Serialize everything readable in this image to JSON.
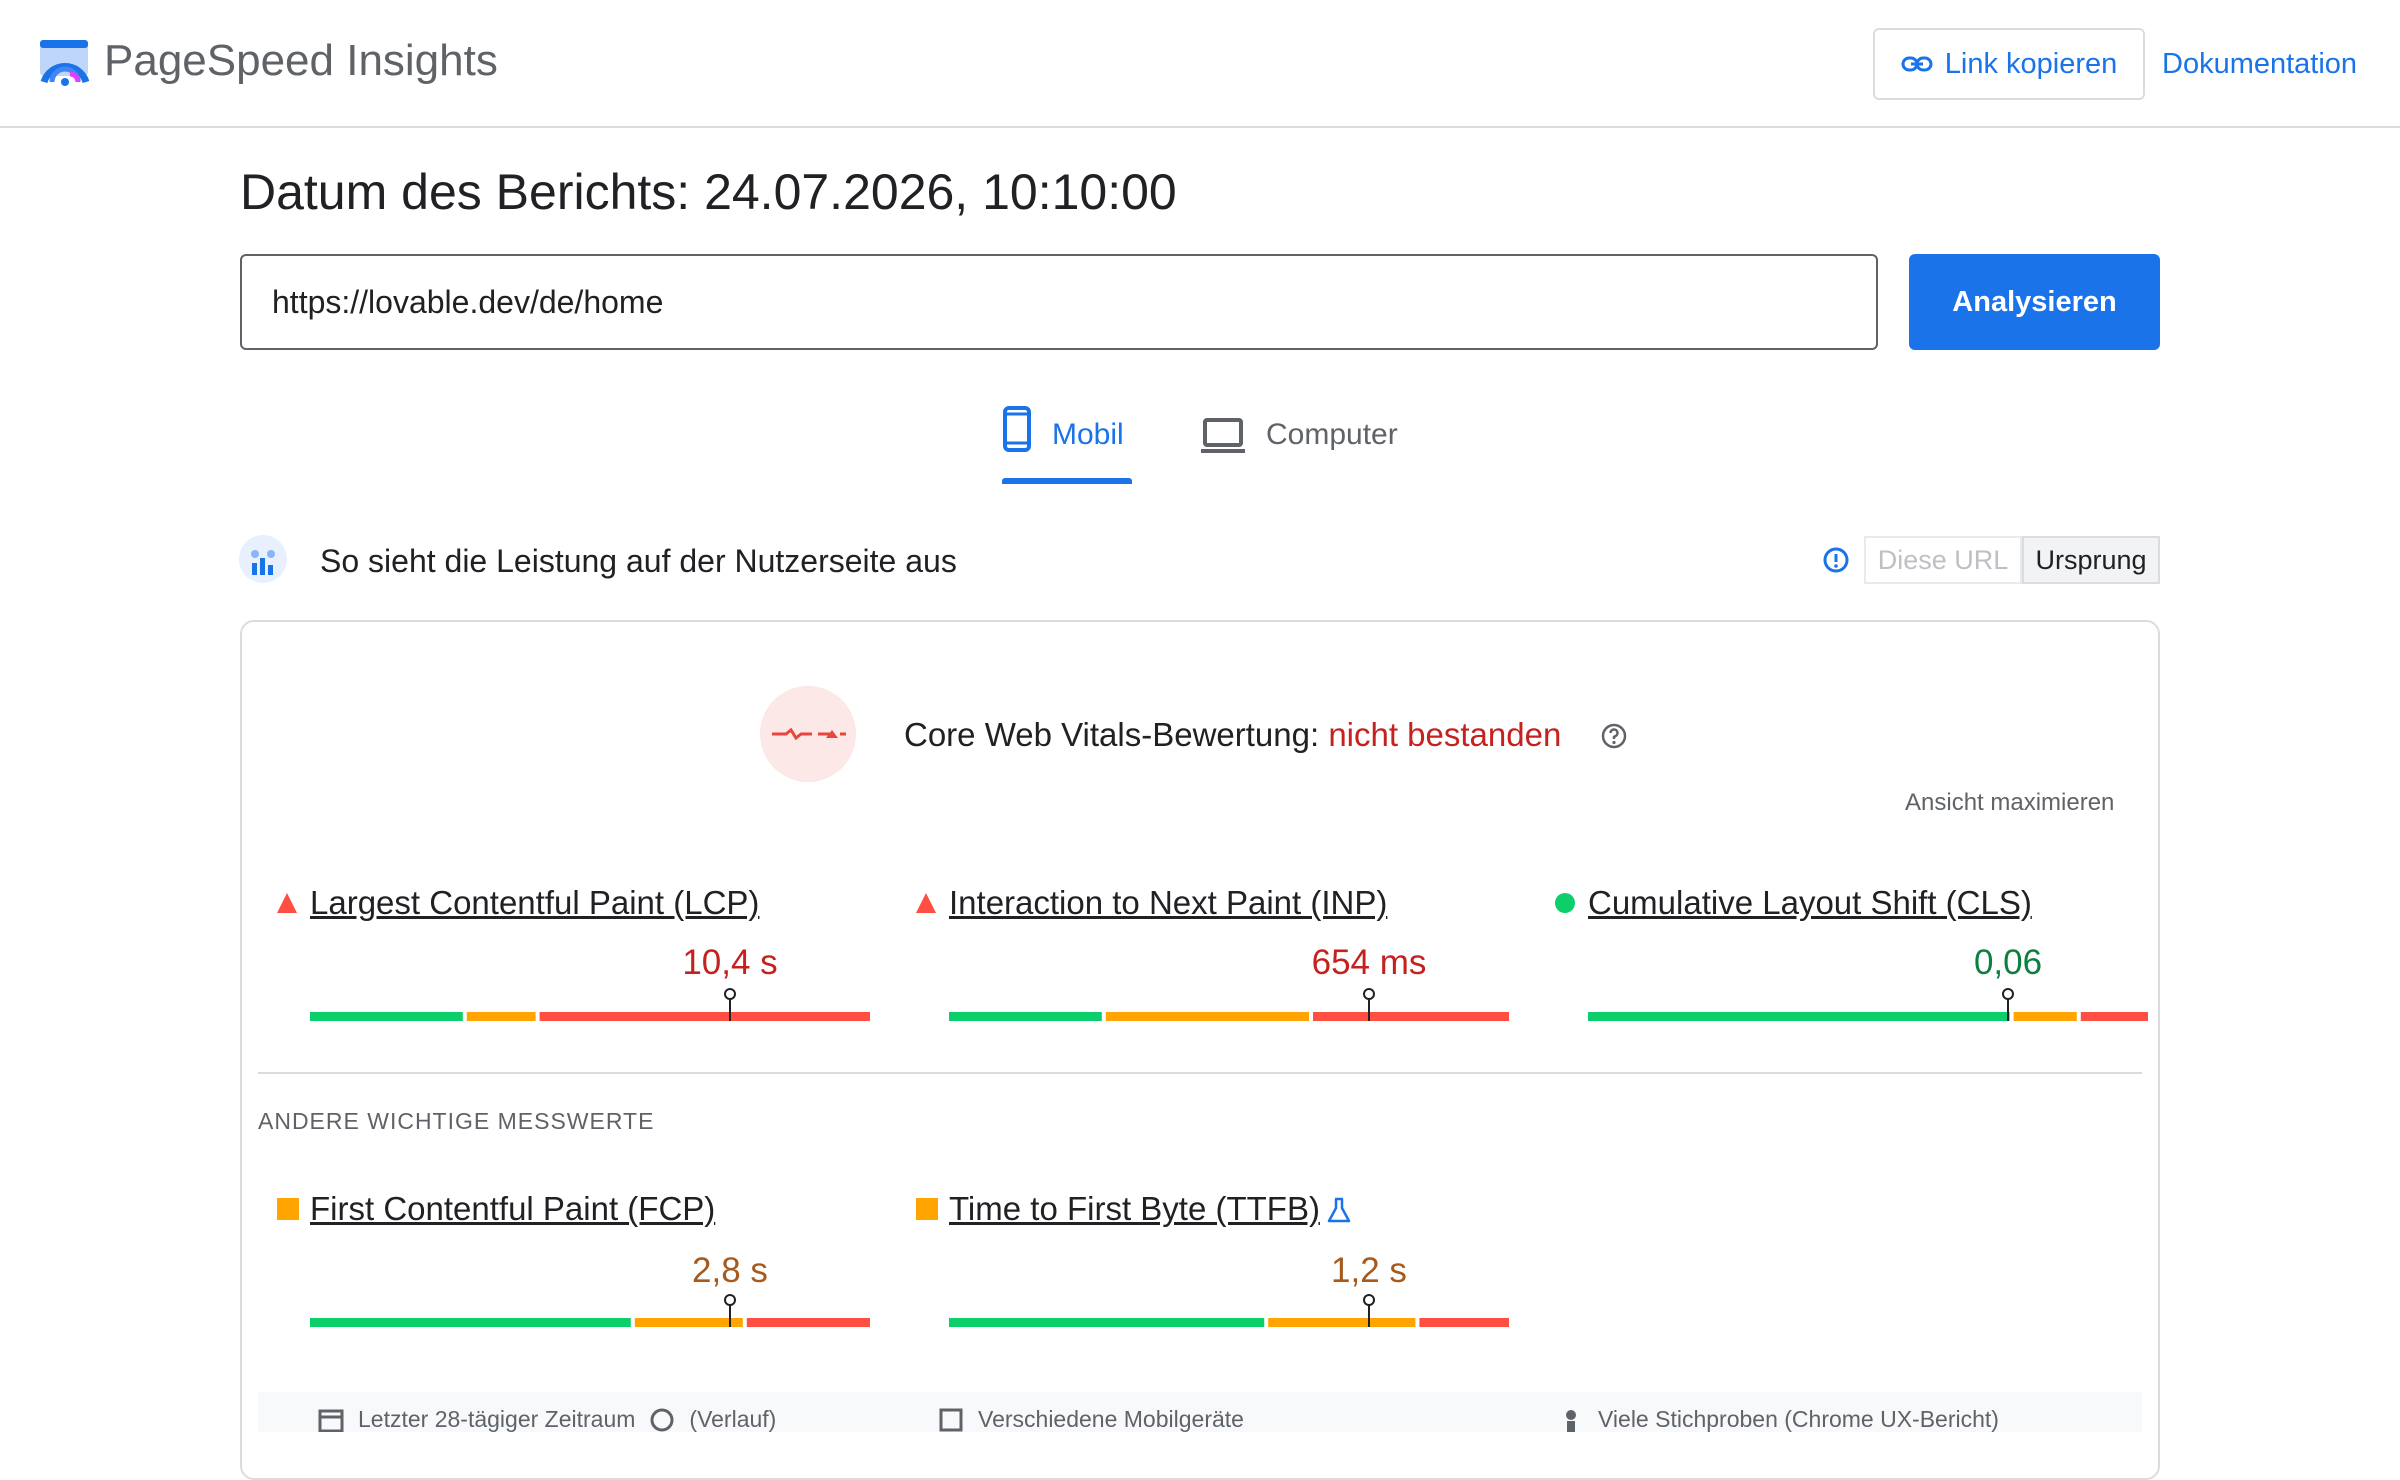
{
  "header": {
    "brand": "PageSpeed Insights",
    "copy_link_label": "Link kopieren",
    "documentation_label": "Dokumentation"
  },
  "report": {
    "date_label": "Datum des Berichts: 24.07.2026, 10:10:00"
  },
  "url_input": {
    "value": "https://lovable.dev/de/home"
  },
  "analyze_label": "Analysieren",
  "tabs": [
    {
      "label": "Mobil",
      "selected": true
    },
    {
      "label": "Computer",
      "selected": false
    }
  ],
  "field_data": {
    "title": "So sieht die Leistung auf der Nutzerseite aus",
    "toggle": {
      "this_url": "Diese URL",
      "origin": "Ursprung"
    }
  },
  "cwv": {
    "prefix": "Core Web Vitals-Bewertung: ",
    "status": "nicht bestanden",
    "expand_label": "Ansicht maximieren"
  },
  "colors": {
    "good": "#0cce6b",
    "needs_improvement": "#ffa400",
    "poor": "#ff4e42",
    "value_poor": "#c5221f",
    "value_good": "#0d7f3f",
    "value_average": "#a65a1e"
  },
  "metrics": [
    {
      "name": "Largest Contentful Paint (LCP)",
      "value": "10,4 s",
      "rating": "poor",
      "distribution": [
        0.28,
        0.13,
        0.59
      ],
      "marker": 0.75
    },
    {
      "name": "Interaction to Next Paint (INP)",
      "value": "654 ms",
      "rating": "poor",
      "distribution": [
        0.28,
        0.37,
        0.35
      ],
      "marker": 0.75
    },
    {
      "name": "Cumulative Layout Shift (CLS)",
      "value": "0,06",
      "rating": "good",
      "distribution": [
        0.76,
        0.12,
        0.12
      ],
      "marker": 0.75
    }
  ],
  "other_metrics_label": "ANDERE WICHTIGE MESSWERTE",
  "other_metrics": [
    {
      "name": "First Contentful Paint (FCP)",
      "value": "2,8 s",
      "rating": "average",
      "distribution": [
        0.58,
        0.2,
        0.22
      ],
      "marker": 0.75
    },
    {
      "name": "Time to First Byte (TTFB)",
      "value": "1,2 s",
      "rating": "average",
      "distribution": [
        0.57,
        0.27,
        0.16
      ],
      "marker": 0.75
    }
  ],
  "footer": {
    "period": "Letzter 28-tägiger Zeitraum",
    "history": "(Verlauf)",
    "devices": "Verschiedene Mobilgeräte",
    "samples": "Viele Stichproben (Chrome UX-Bericht)"
  }
}
